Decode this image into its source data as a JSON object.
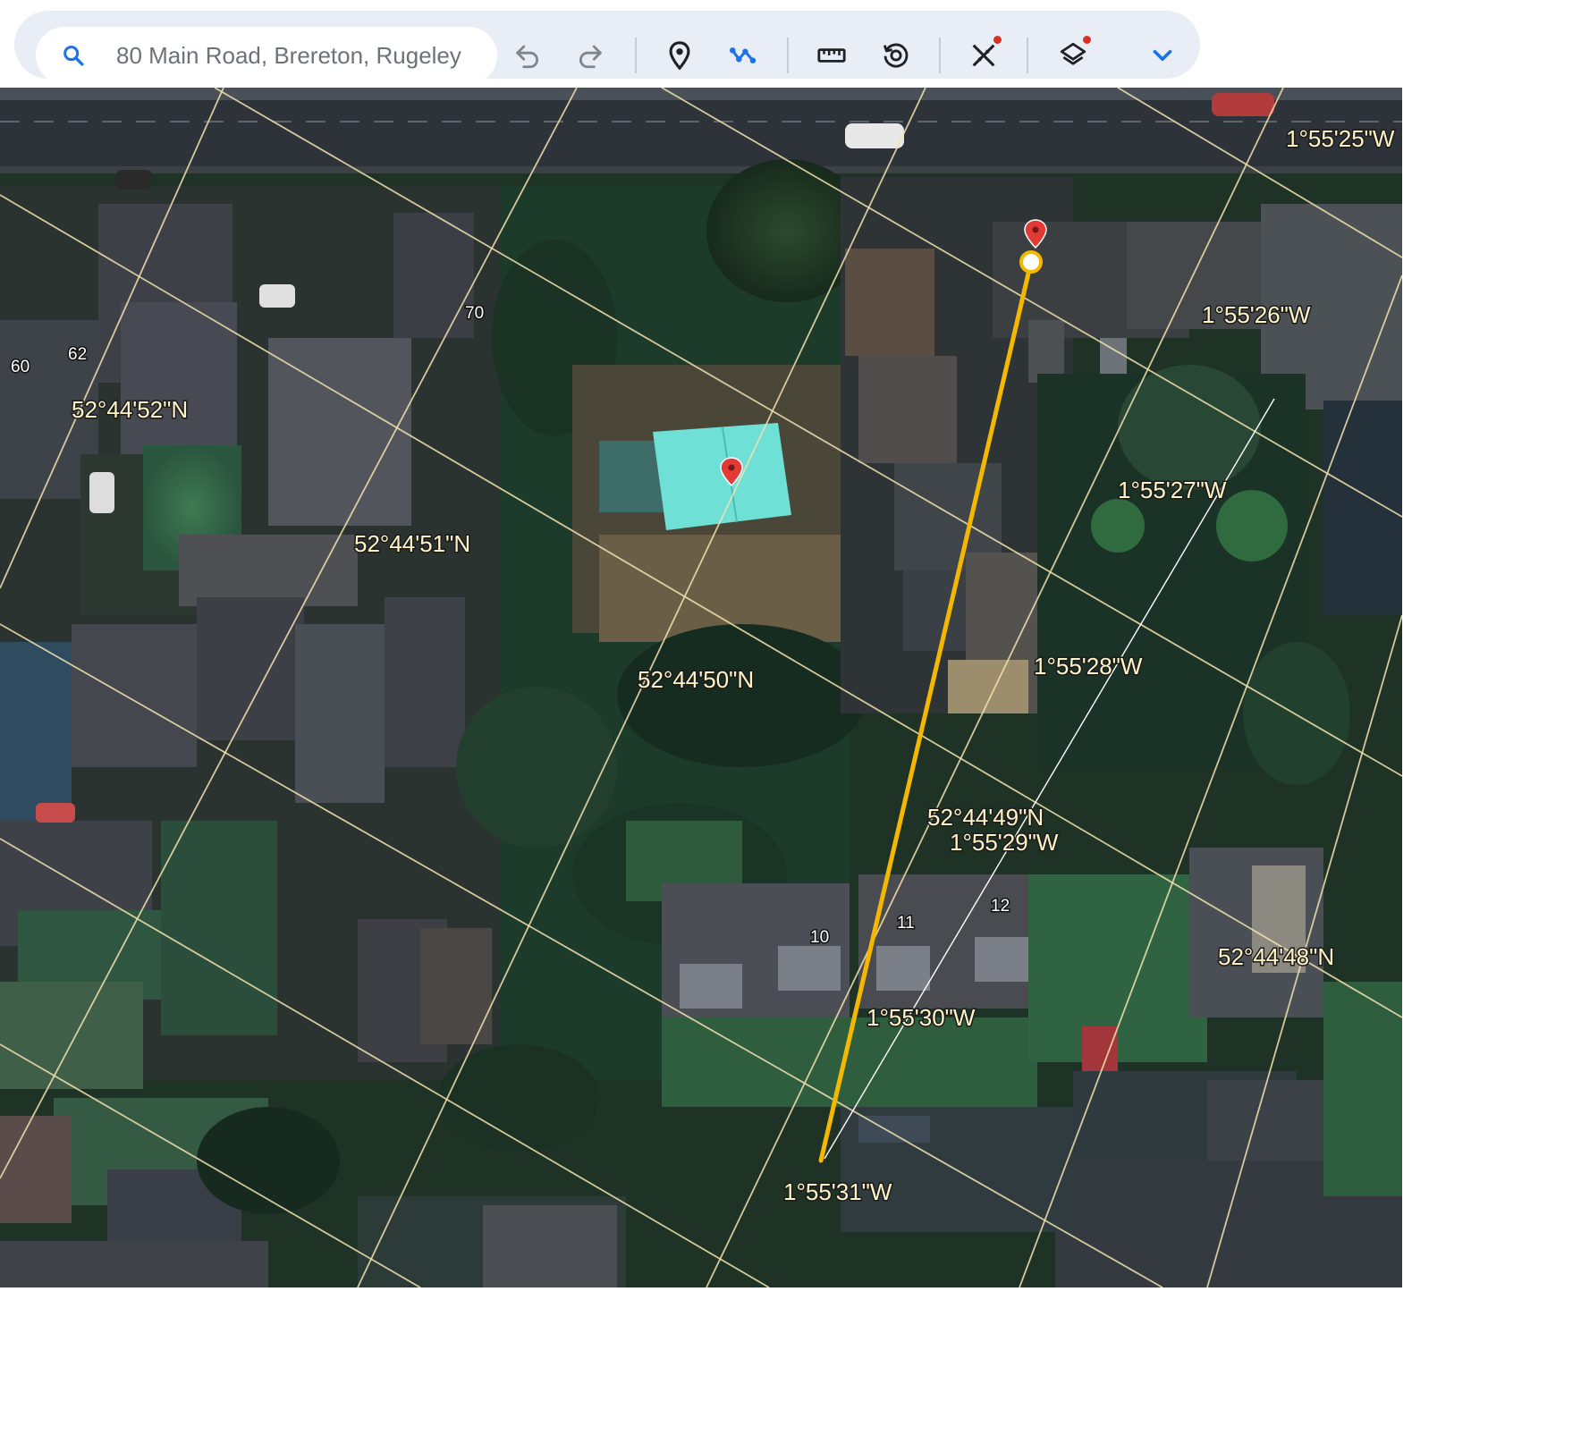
{
  "search": {
    "placeholder": "80 Main Road, Brereton, Rugeley"
  },
  "toolbar": {
    "icons": [
      "search-icon",
      "undo-icon",
      "redo-icon",
      "place-marker-icon",
      "path-icon",
      "ruler-icon",
      "historical-imagery-icon",
      "measure-tool-icon",
      "layers-icon",
      "chevron-down-icon"
    ],
    "accent": "#1a73e8",
    "notification_dot": "#d93025"
  },
  "map": {
    "grid_color": "#f3e2b0",
    "path_color": "#f5b800",
    "latitude_labels": [
      "52°44'52\"N",
      "52°44'51\"N",
      "52°44'50\"N",
      "52°44'49\"N",
      "52°44'48\"N"
    ],
    "longitude_labels": [
      "1°55'25\"W",
      "1°55'26\"W",
      "1°55'27\"W",
      "1°55'28\"W",
      "1°55'29\"W",
      "1°55'30\"W",
      "1°55'31\"W"
    ],
    "house_numbers": [
      "60",
      "62",
      "70",
      "10",
      "11",
      "12"
    ]
  }
}
